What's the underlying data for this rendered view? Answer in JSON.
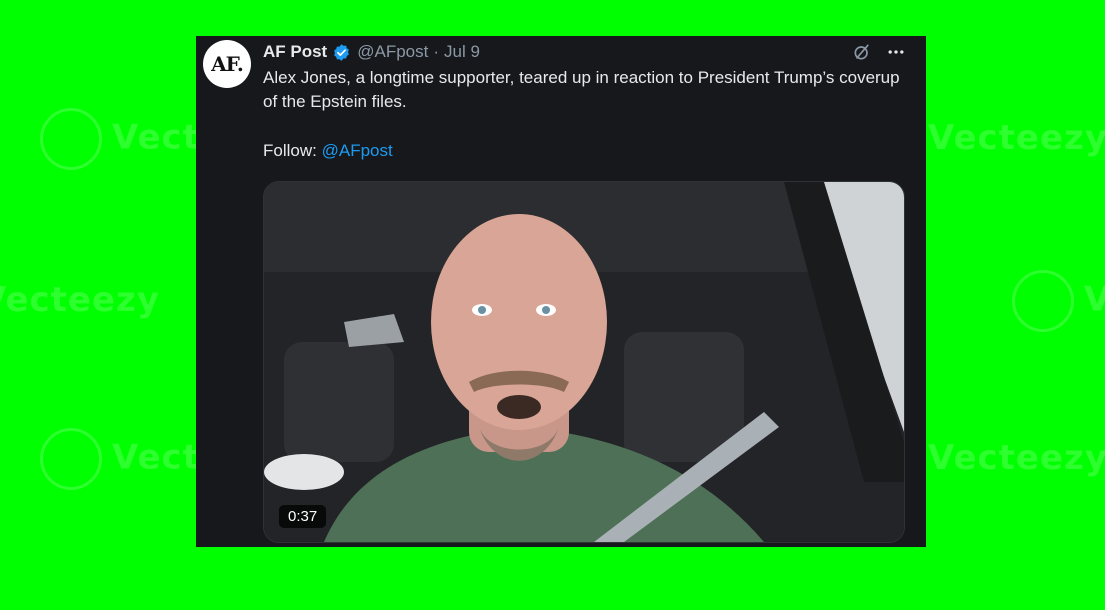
{
  "colors": {
    "background": "#00ff00",
    "card": "#16181c",
    "text": "#e7e9ea",
    "muted": "#8b98a5",
    "link": "#1d9bf0",
    "verified": "#1d9bf0"
  },
  "tweet": {
    "avatar_text": "AF.",
    "display_name": "AF Post",
    "verified_icon": "verified-badge-icon",
    "handle": "@AFpost",
    "separator": "·",
    "date": "Jul 9",
    "grok_icon": "grok-icon",
    "more_icon": "more-icon",
    "text": "Alex Jones, a longtime supporter, teared up in reaction to President Trump’s coverup of the Epstein files.",
    "follow_label": "Follow:",
    "follow_link": "@AFpost",
    "video": {
      "duration": "0:37"
    }
  },
  "watermarks": [
    "Vecteezy",
    "Vecteezy",
    "Vecteezy",
    "Vecteezy",
    "Vecteezy",
    "Vecteezy",
    "Vecteezy",
    "Vecteezy"
  ]
}
